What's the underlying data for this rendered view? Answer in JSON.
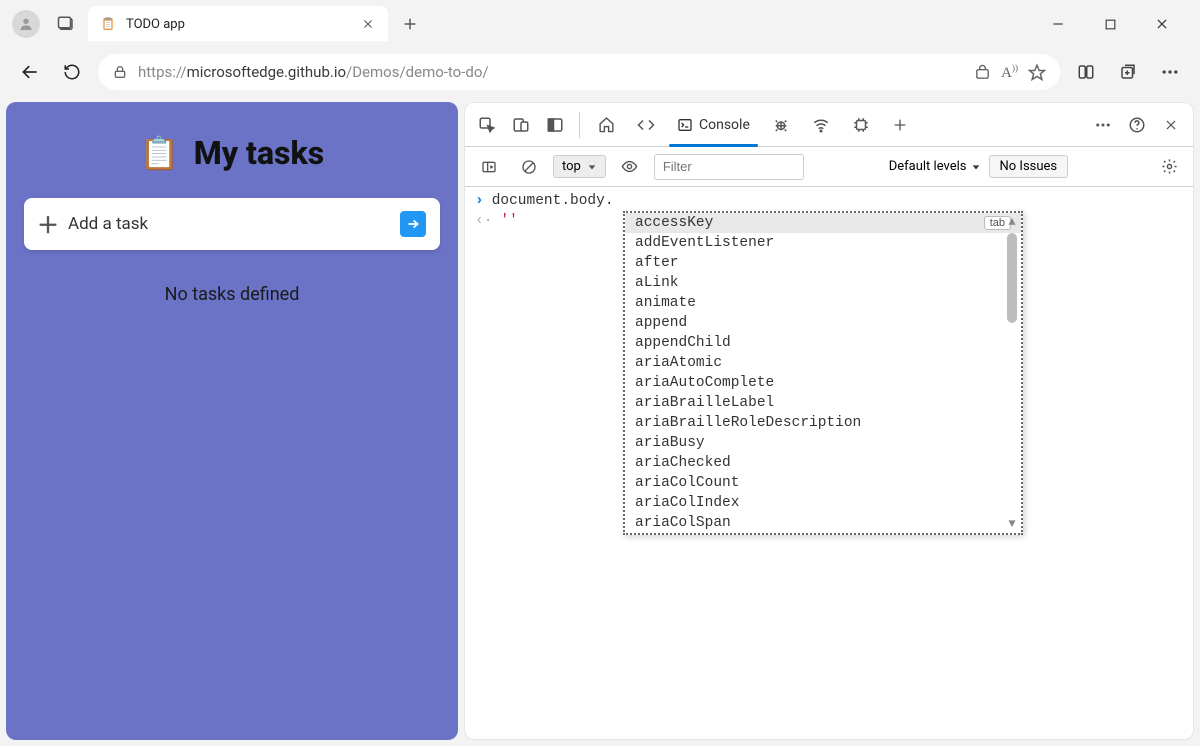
{
  "browser": {
    "tab": {
      "title": "TODO app"
    },
    "url_prefix": "https://",
    "url_host": "microsoftedge.github.io",
    "url_path": "/Demos/demo-to-do/"
  },
  "app": {
    "heading": "My tasks",
    "add_placeholder": "Add a task",
    "empty": "No tasks defined"
  },
  "devtools": {
    "tab_console": "Console",
    "context": "top",
    "filter_placeholder": "Filter",
    "levels": "Default levels",
    "issues": "No Issues",
    "prompt": "document.body.",
    "result": "''",
    "tab_hint": "tab",
    "suggestions": [
      "accessKey",
      "addEventListener",
      "after",
      "aLink",
      "animate",
      "append",
      "appendChild",
      "ariaAtomic",
      "ariaAutoComplete",
      "ariaBrailleLabel",
      "ariaBrailleRoleDescription",
      "ariaBusy",
      "ariaChecked",
      "ariaColCount",
      "ariaColIndex",
      "ariaColSpan"
    ]
  }
}
